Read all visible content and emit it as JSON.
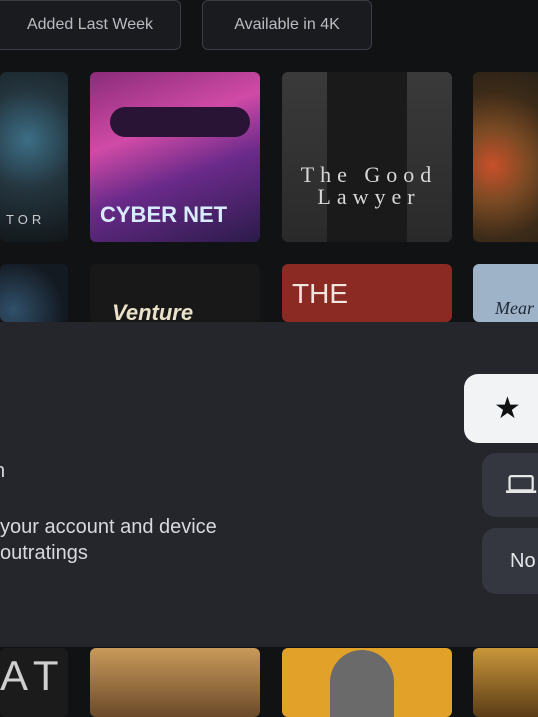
{
  "filters": {
    "added_last_week": "Added Last Week",
    "available_4k": "Available in 4K"
  },
  "posters": {
    "row1": [
      "TOR",
      "CYBER NET",
      "The Good Lawyer",
      ""
    ],
    "row2": [
      "",
      "Venture",
      "THE",
      "Mear"
    ],
    "row3": [
      "AT",
      "",
      "",
      ""
    ]
  },
  "panel": {
    "title_fragment": "n",
    "description_line1": "your account and device",
    "description_line2": "outratings",
    "buttons": {
      "rate_icon": "star-icon",
      "devices_icon": "devices-icon",
      "not_now_label": "No"
    }
  },
  "colors": {
    "background": "#111214",
    "panel": "#24262b",
    "primary_button": "#f2f3f5",
    "secondary_button": "#343740"
  }
}
